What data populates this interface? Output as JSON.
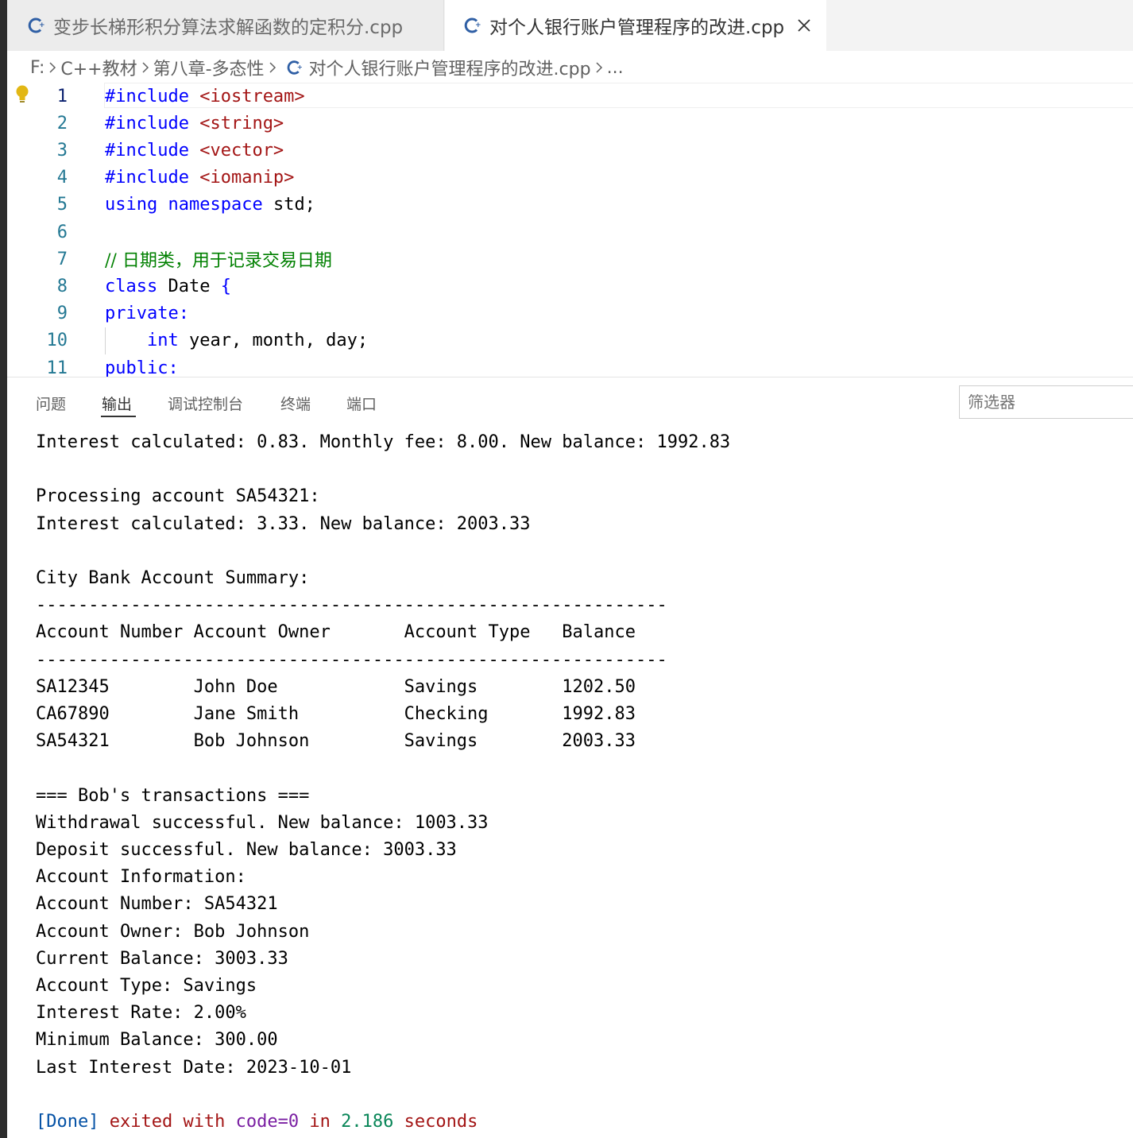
{
  "tabs": [
    {
      "label": "变步长梯形积分算法求解函数的定积分.cpp",
      "active": false
    },
    {
      "label": "对个人银行账户管理程序的改进.cpp",
      "active": true
    }
  ],
  "breadcrumb": [
    "F:",
    "C++教材",
    "第八章-多态性",
    "对个人银行账户管理程序的改进.cpp",
    "..."
  ],
  "editor": {
    "lines": [
      {
        "n": "1",
        "tokens": [
          {
            "t": "#include ",
            "c": "k-dir"
          },
          {
            "t": "<iostream>",
            "c": "k-str"
          }
        ]
      },
      {
        "n": "2",
        "tokens": [
          {
            "t": "#include ",
            "c": "k-dir"
          },
          {
            "t": "<string>",
            "c": "k-str"
          }
        ]
      },
      {
        "n": "3",
        "tokens": [
          {
            "t": "#include ",
            "c": "k-dir"
          },
          {
            "t": "<vector>",
            "c": "k-str"
          }
        ]
      },
      {
        "n": "4",
        "tokens": [
          {
            "t": "#include ",
            "c": "k-dir"
          },
          {
            "t": "<iomanip>",
            "c": "k-str"
          }
        ]
      },
      {
        "n": "5",
        "tokens": [
          {
            "t": "using",
            "c": "k-kw"
          },
          {
            "t": " ",
            "c": "k-tx"
          },
          {
            "t": "namespace",
            "c": "k-kw"
          },
          {
            "t": " std;",
            "c": "k-tx"
          }
        ]
      },
      {
        "n": "6",
        "tokens": []
      },
      {
        "n": "7",
        "tokens": [
          {
            "t": "// 日期类，用于记录交易日期",
            "c": "k-cm"
          }
        ]
      },
      {
        "n": "8",
        "tokens": [
          {
            "t": "class",
            "c": "k-kw"
          },
          {
            "t": " Date ",
            "c": "k-tx"
          },
          {
            "t": "{",
            "c": "k-kw"
          }
        ]
      },
      {
        "n": "9",
        "tokens": [
          {
            "t": "private:",
            "c": "k-kw"
          }
        ]
      },
      {
        "n": "10",
        "tokens": [
          {
            "t": "    ",
            "c": "k-tx"
          },
          {
            "t": "int",
            "c": "k-kw"
          },
          {
            "t": " year, month, day;",
            "c": "k-tx"
          }
        ]
      },
      {
        "n": "11",
        "tokens": [
          {
            "t": "public:",
            "c": "k-kw"
          }
        ]
      }
    ]
  },
  "panel": {
    "tabs": [
      "问题",
      "输出",
      "调试控制台",
      "终端",
      "端口"
    ],
    "active_tab": "输出",
    "filter_placeholder": "筛选器"
  },
  "output": {
    "lines": [
      "Interest calculated: 0.83. Monthly fee: 8.00. New balance: 1992.83",
      "",
      "Processing account SA54321:",
      "Interest calculated: 3.33. New balance: 2003.33",
      "",
      "City Bank Account Summary:",
      "------------------------------------------------------------",
      "Account Number Account Owner       Account Type   Balance",
      "------------------------------------------------------------",
      "SA12345        John Doe            Savings        1202.50",
      "CA67890        Jane Smith          Checking       1992.83",
      "SA54321        Bob Johnson         Savings        2003.33",
      "",
      "=== Bob's transactions ===",
      "Withdrawal successful. New balance: 1003.33",
      "Deposit successful. New balance: 3003.33",
      "Account Information:",
      "Account Number: SA54321",
      "Account Owner: Bob Johnson",
      "Current Balance: 3003.33",
      "Account Type: Savings",
      "Interest Rate: 2.00%",
      "Minimum Balance: 300.00",
      "Last Interest Date: 2023-10-01",
      ""
    ],
    "done": {
      "tag": "[Done]",
      "text1": " exited with ",
      "code": "code=0",
      "text2": " in ",
      "time": "2.186",
      "text3": " seconds"
    }
  },
  "colors": {
    "cpp_icon": "#2f5fa5",
    "line_number": "#237893",
    "keyword": "#0000ff",
    "string": "#a31515",
    "comment": "#008000",
    "lightbulb": "#e2b714"
  }
}
